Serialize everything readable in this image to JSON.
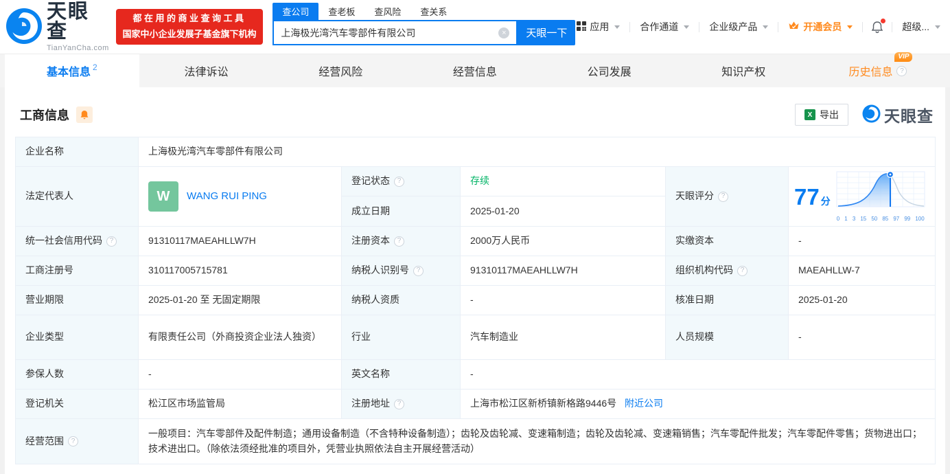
{
  "header": {
    "logo_text": "天眼查",
    "logo_domain": "TianYanCha.com",
    "banner_line1": "都在用的商业查询工具",
    "banner_line2": "国家中小企业发展子基金旗下机构",
    "search_tabs": [
      {
        "label": "查公司"
      },
      {
        "label": "查老板"
      },
      {
        "label": "查风险"
      },
      {
        "label": "查关系"
      }
    ],
    "search_value": "上海极光湾汽车零部件有限公司",
    "search_button": "天眼一下",
    "nav": {
      "apps": "应用",
      "cooperation": "合作通道",
      "enterprise": "企业级产品",
      "vip": "开通会员",
      "super": "超级..."
    }
  },
  "tabs": [
    {
      "label": "基本信息",
      "badge": "2"
    },
    {
      "label": "法律诉讼"
    },
    {
      "label": "经营风险"
    },
    {
      "label": "经营信息"
    },
    {
      "label": "公司发展"
    },
    {
      "label": "知识产权"
    },
    {
      "label": "历史信息",
      "vip_badge": "VIP"
    }
  ],
  "section": {
    "title": "工商信息",
    "export_label": "导出",
    "watermark_text": "天眼查"
  },
  "table": {
    "company_name": {
      "label": "企业名称",
      "value": "上海极光湾汽车零部件有限公司"
    },
    "legal_rep": {
      "label": "法定代表人",
      "avatar": "W",
      "name": "WANG RUI PING"
    },
    "reg_status": {
      "label": "登记状态",
      "value": "存续"
    },
    "establish_date": {
      "label": "成立日期",
      "value": "2025-01-20"
    },
    "score": {
      "label": "天眼评分",
      "value": "77",
      "unit": "分"
    },
    "credit_code": {
      "label": "统一社会信用代码",
      "value": "91310117MAEAHLLW7H"
    },
    "reg_capital": {
      "label": "注册资本",
      "value": "2000万人民币"
    },
    "paid_capital": {
      "label": "实缴资本",
      "value": "-"
    },
    "reg_number": {
      "label": "工商注册号",
      "value": "310117005715781"
    },
    "taxpayer_id": {
      "label": "纳税人识别号",
      "value": "91310117MAEAHLLW7H"
    },
    "org_code": {
      "label": "组织机构代码",
      "value": "MAEAHLLW-7"
    },
    "business_term": {
      "label": "营业期限",
      "value": "2025-01-20 至 无固定期限"
    },
    "taxpayer_quality": {
      "label": "纳税人资质",
      "value": "-"
    },
    "approval_date": {
      "label": "核准日期",
      "value": "2025-01-20"
    },
    "company_type": {
      "label": "企业类型",
      "value": "有限责任公司（外商投资企业法人独资）"
    },
    "industry": {
      "label": "行业",
      "value": "汽车制造业"
    },
    "staff_size": {
      "label": "人员规模",
      "value": "-"
    },
    "insured_count": {
      "label": "参保人数",
      "value": "-"
    },
    "english_name": {
      "label": "英文名称",
      "value": "-"
    },
    "reg_authority": {
      "label": "登记机关",
      "value": "松江区市场监管局"
    },
    "reg_address": {
      "label": "注册地址",
      "value": "上海市松江区新桥镇新格路9446号",
      "link": "附近公司"
    },
    "business_scope": {
      "label": "经营范围",
      "value": "一般项目：汽车零部件及配件制造；通用设备制造（不含特种设备制造）；齿轮及齿轮减、变速箱制造；齿轮及齿轮减、变速箱销售；汽车零配件批发；汽车零配件零售；货物进出口；技术进出口。（除依法须经批准的项目外，凭营业执照依法自主开展经营活动）"
    }
  },
  "chart_data": {
    "type": "area",
    "title": "天眼评分分布曲线",
    "score": 77,
    "score_unit": "分",
    "x_ticks": [
      "0",
      "1",
      "3",
      "15",
      "50",
      "85",
      "97",
      "99",
      "100"
    ],
    "marker_position": 77,
    "curve_color": "#2f87f2",
    "tail_color": "#c6d5e3",
    "grid": true
  },
  "icons": {
    "help_glyph": "?",
    "clear_glyph": "×",
    "excel_glyph": "X"
  },
  "colors": {
    "brand_blue": "#0a7cf0",
    "banner_red": "#e6281e",
    "vip_orange": "#ff8a1e",
    "status_green": "#00b365",
    "avatar_green": "#74c69d",
    "label_bg": "#f2f9fc",
    "table_border": "#e9eff6"
  }
}
